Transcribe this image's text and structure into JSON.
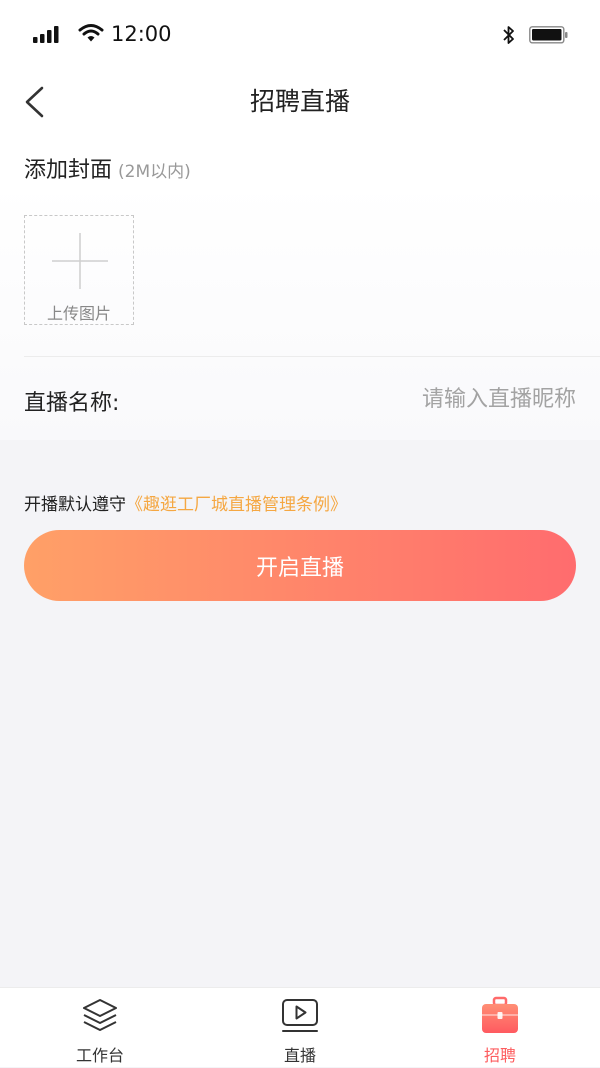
{
  "status": {
    "time": "12:00"
  },
  "header": {
    "title": "招聘直播"
  },
  "cover": {
    "label": "添加封面",
    "hint": "(2M以内)",
    "upload_text": "上传图片"
  },
  "live_name": {
    "label": "直播名称:",
    "value": "",
    "placeholder": "请输入直播昵称"
  },
  "rules": {
    "prefix": "开播默认遵守",
    "link": "《趣逛工厂城直播管理条例》"
  },
  "start_button": {
    "label": "开启直播"
  },
  "tabs": [
    {
      "label": "工作台",
      "icon": "layers-icon"
    },
    {
      "label": "直播",
      "icon": "play-screen-icon"
    },
    {
      "label": "招聘",
      "icon": "briefcase-icon",
      "active": true
    }
  ],
  "colors": {
    "accent_start": "#ffa067",
    "accent_end": "#ff6c6e",
    "link": "#f5a742",
    "active_tab": "#fd5d5f"
  }
}
